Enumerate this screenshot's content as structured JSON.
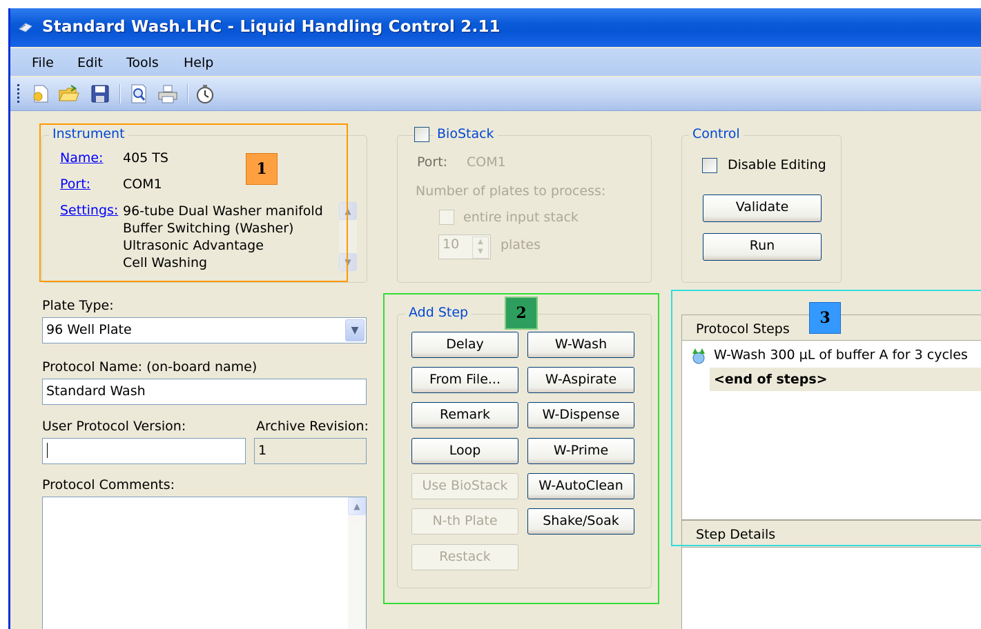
{
  "window": {
    "title": "Standard Wash.LHC - Liquid Handling Control 2.11"
  },
  "menu": [
    "File",
    "Edit",
    "Tools",
    "Help"
  ],
  "toolbar": {
    "icons": [
      "new-file-icon",
      "open-folder-icon",
      "save-icon",
      "print-preview-icon",
      "print-icon",
      "timer-icon"
    ]
  },
  "instrument": {
    "legend": "Instrument",
    "name_label": "Name:",
    "name_value": "405 TS",
    "port_label": "Port:",
    "port_value": "COM1",
    "settings_label": "Settings:",
    "settings": [
      "96-tube Dual Washer manifold",
      "Buffer Switching (Washer)",
      "Ultrasonic Advantage",
      "Cell Washing"
    ]
  },
  "biostack": {
    "legend": "BioStack",
    "checked": false,
    "port_label": "Port:",
    "port_value": "COM1",
    "plates_label": "Number of plates to process:",
    "entire_stack_label": "entire input stack",
    "plates_value": "10",
    "plates_unit": "plates"
  },
  "control": {
    "legend": "Control",
    "disable_editing_label": "Disable Editing",
    "validate_label": "Validate",
    "run_label": "Run"
  },
  "form": {
    "plate_type_label": "Plate Type:",
    "plate_type_value": "96 Well Plate",
    "protocol_name_label": "Protocol Name:  (on-board name)",
    "protocol_name_value": "Standard Wash",
    "user_version_label": "User Protocol Version:",
    "user_version_value": "",
    "archive_label": "Archive Revision:",
    "archive_value": "1",
    "comments_label": "Protocol Comments:"
  },
  "add_step": {
    "legend": "Add Step",
    "left_buttons": [
      "Delay",
      "From File...",
      "Remark",
      "Loop",
      "Use BioStack",
      "N-th Plate",
      "Restack"
    ],
    "right_buttons": [
      "W-Wash",
      "W-Aspirate",
      "W-Dispense",
      "W-Prime",
      "W-AutoClean",
      "Shake/Soak"
    ]
  },
  "protocol_steps": {
    "header": "Protocol Steps",
    "items": [
      "W-Wash 300 µL of buffer A for 3 cycles"
    ],
    "end_marker": "<end of steps>"
  },
  "step_details": {
    "header": "Step Details"
  },
  "annotations": [
    {
      "label": "1",
      "color": "#ff9900",
      "badge_bg": "#ffa040"
    },
    {
      "label": "2",
      "color": "#33dd33",
      "badge_bg": "#2e9e5e"
    },
    {
      "label": "3",
      "color": "#33dddd",
      "badge_bg": "#3399ff"
    }
  ]
}
